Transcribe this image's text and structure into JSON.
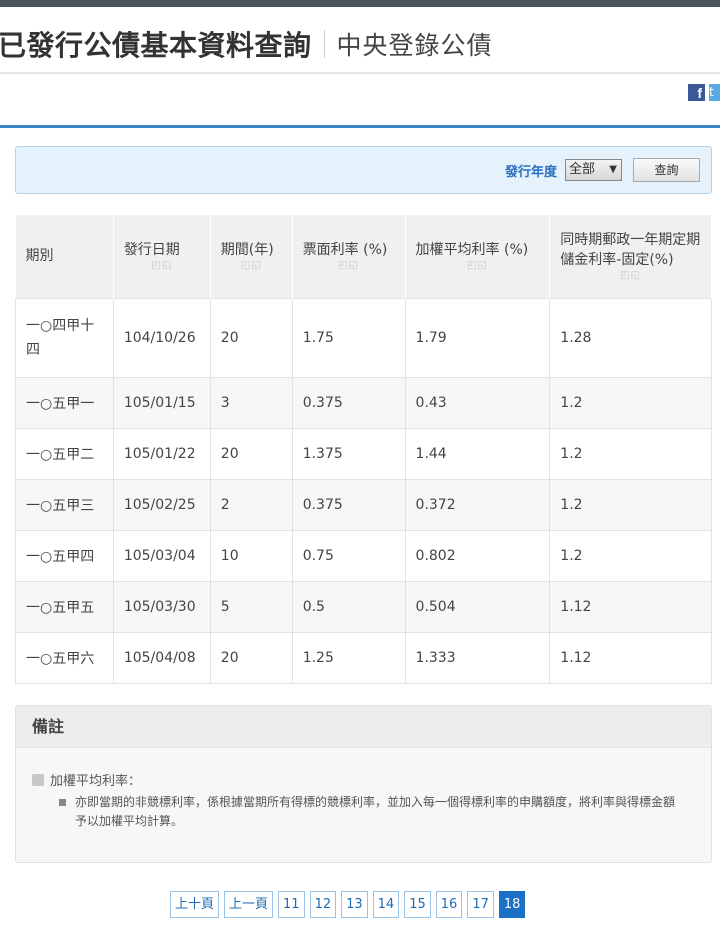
{
  "header": {
    "title": "已發行公債基本資料查詢",
    "subtitle": "中央登錄公債"
  },
  "social": {
    "facebook_glyph": "f",
    "twitter_glyph": "t"
  },
  "filter": {
    "label": "發行年度",
    "selected": "全部",
    "select_arrow": "▼",
    "query_button": "查詢"
  },
  "table": {
    "columns": [
      "期別",
      "發行日期",
      "期間(年)",
      "票面利率 (%)",
      "加權平均利率 (%)",
      "同時期郵政一年期定期儲金利率-固定(%)"
    ],
    "sort_glyph": "◰◱",
    "rows": [
      [
        "一○四甲十四",
        "104/10/26",
        "20",
        "1.75",
        "1.79",
        "1.28"
      ],
      [
        "一○五甲一",
        "105/01/15",
        "3",
        "0.375",
        "0.43",
        "1.2"
      ],
      [
        "一○五甲二",
        "105/01/22",
        "20",
        "1.375",
        "1.44",
        "1.2"
      ],
      [
        "一○五甲三",
        "105/02/25",
        "2",
        "0.375",
        "0.372",
        "1.2"
      ],
      [
        "一○五甲四",
        "105/03/04",
        "10",
        "0.75",
        "0.802",
        "1.2"
      ],
      [
        "一○五甲五",
        "105/03/30",
        "5",
        "0.5",
        "0.504",
        "1.12"
      ],
      [
        "一○五甲六",
        "105/04/08",
        "20",
        "1.25",
        "1.333",
        "1.12"
      ]
    ]
  },
  "notes": {
    "title": "備註",
    "item": "加權平均利率：",
    "detail": "亦即當期的非競標利率，係根據當期所有得標的競標利率，並加入每一個得標利率的申購額度，將利率與得標金額予以加權平均計算。"
  },
  "pager": {
    "prev10": "上十頁",
    "prev": "上一頁",
    "pages": [
      "11",
      "12",
      "13",
      "14",
      "15",
      "16",
      "17",
      "18"
    ],
    "active": "18"
  },
  "colors": {
    "accent": "#3d85c8",
    "filter_bg": "#e6f2fb",
    "pager_active": "#1a6fc7"
  }
}
